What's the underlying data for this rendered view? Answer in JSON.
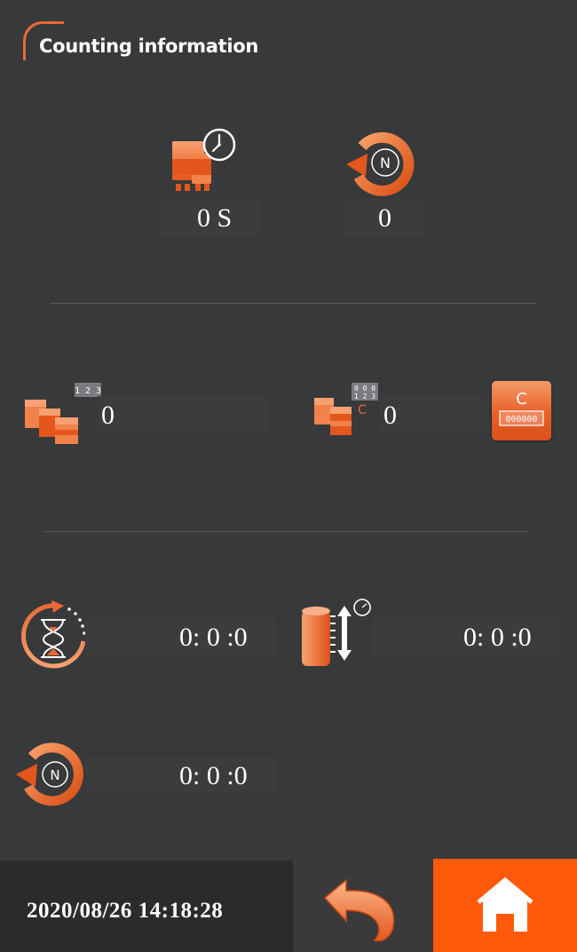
{
  "header": {
    "title": "Counting information"
  },
  "stats": {
    "cycle_time": "0 S",
    "cycle_count": "0",
    "product_total": "0",
    "product_resettable": "0",
    "countdown_time": "0: 0 :0",
    "roll_time": "0: 0 :0",
    "run_time": "0: 0 :0"
  },
  "reset_button": {
    "glyph": "C",
    "digits": "000000"
  },
  "icons": {
    "machine_clock": "machine-clock-icon",
    "cycle_n": "cycle-n-icon",
    "products_123": "products-counter-icon",
    "products_reset": "products-reset-counter-icon",
    "hourglass": "hourglass-timer-icon",
    "roll": "film-roll-icon",
    "back": "back-arrow-icon",
    "home": "home-icon"
  },
  "footer": {
    "datetime": "2020/08/26 14:18:28"
  },
  "colors": {
    "accent": "#e96a34",
    "home_bg": "#ff5a0c",
    "background": "#38393b"
  }
}
